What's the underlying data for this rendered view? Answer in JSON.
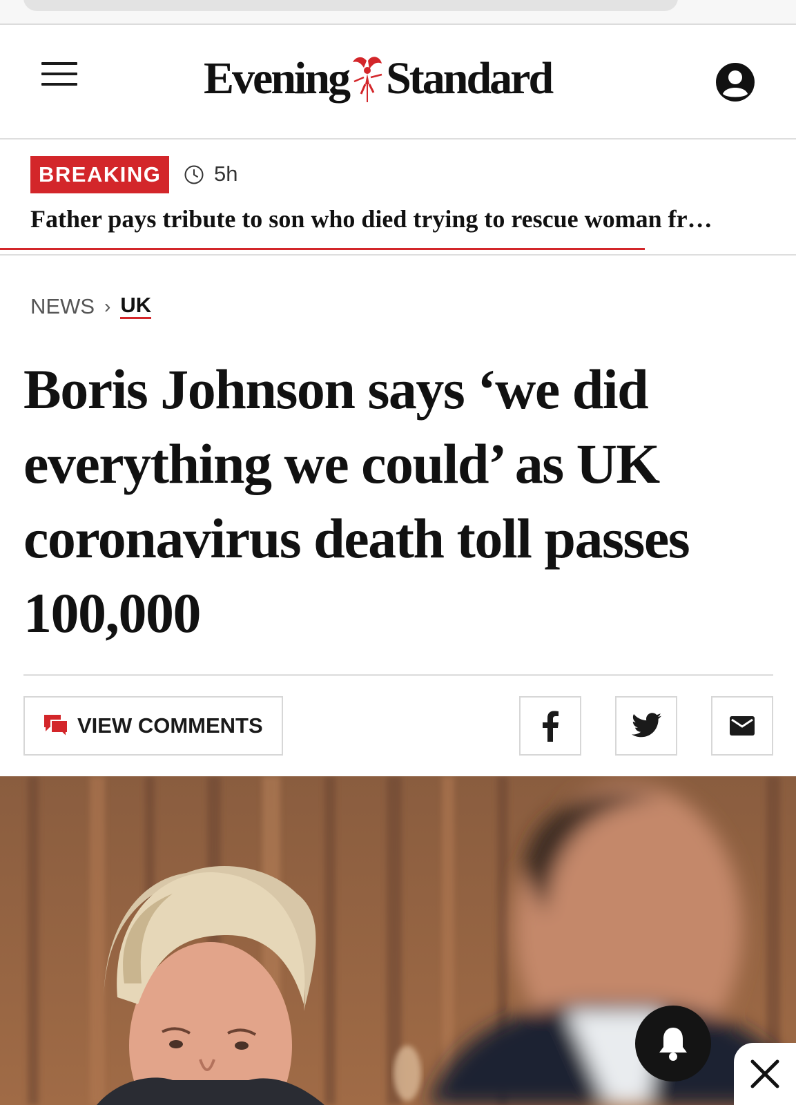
{
  "masthead": {
    "logo_word1": "Evening",
    "logo_word2": "Standard"
  },
  "breaking": {
    "badge": "BREAKING",
    "time": "5h",
    "headline": "Father pays tribute to son who died trying to rescue woman fr…",
    "progress": 0.81
  },
  "breadcrumb": {
    "section": "NEWS",
    "separator": "›",
    "subsection": "UK"
  },
  "article": {
    "headline": "Boris Johnson says ‘we did everything we could’ as UK coronavirus death toll passes 100,000"
  },
  "actions": {
    "comments_label": "VIEW COMMENTS",
    "share": [
      "facebook-icon",
      "twitter-icon",
      "email-icon"
    ]
  },
  "colors": {
    "accent": "#d3262a",
    "text": "#111111",
    "border": "#d7d7d7"
  }
}
